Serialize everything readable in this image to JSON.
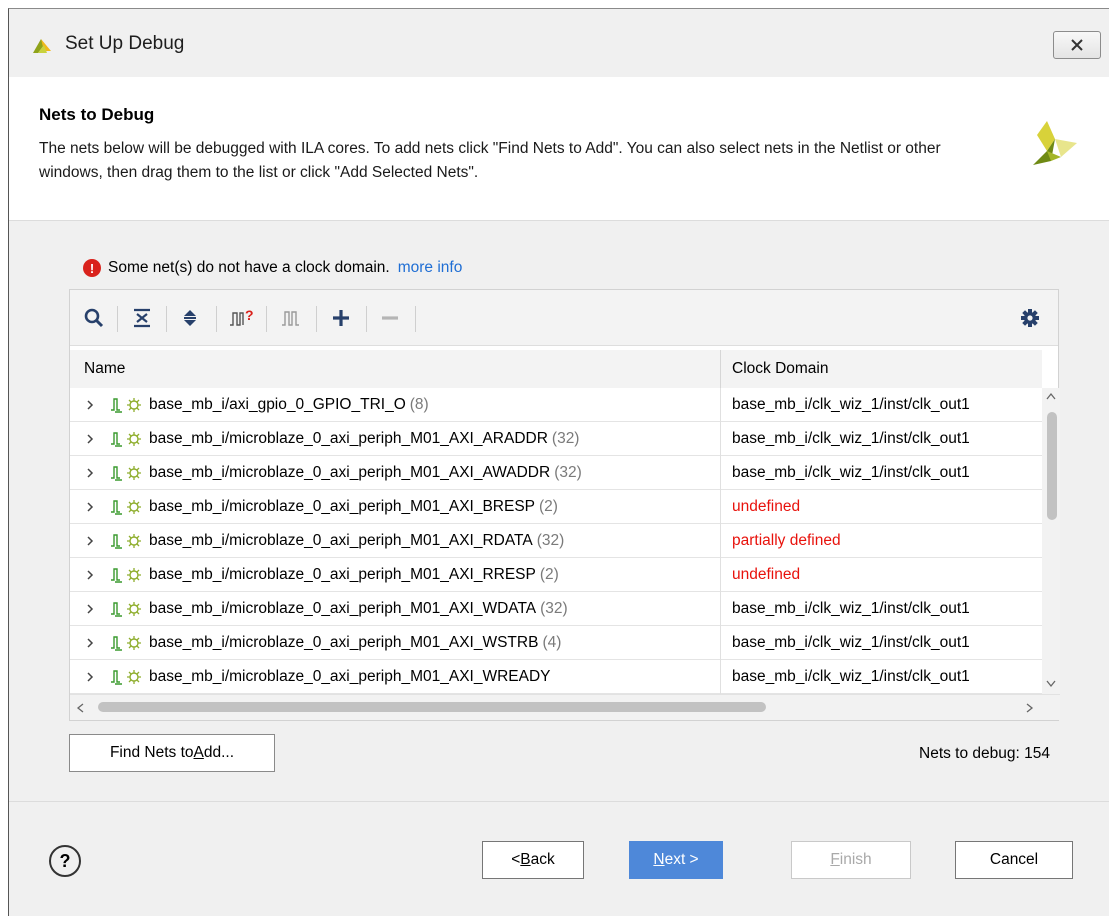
{
  "window": {
    "title": "Set Up Debug",
    "close_icon": "close-x-icon"
  },
  "header": {
    "title": "Nets to Debug",
    "description": "The nets below will be debugged with ILA cores. To add nets click \"Find Nets to Add\". You can also select nets in the Netlist or other windows, then drag them to the list or click \"Add Selected Nets\"."
  },
  "warning": {
    "text": "Some net(s) do not have a clock domain.",
    "link": "more info",
    "icon": "error-icon"
  },
  "toolbar": {
    "icons": [
      "search-icon",
      "collapse-all-icon",
      "expand-all-icon",
      "find-nets-icon",
      "nets-icon",
      "add-icon",
      "remove-icon",
      "settings-icon"
    ]
  },
  "table": {
    "columns": [
      "Name",
      "Clock Domain"
    ],
    "rows": [
      {
        "name": "base_mb_i/axi_gpio_0_GPIO_TRI_O",
        "count": "(8)",
        "clock": "base_mb_i/clk_wiz_1/inst/clk_out1",
        "clock_status": "defined"
      },
      {
        "name": "base_mb_i/microblaze_0_axi_periph_M01_AXI_ARADDR",
        "count": "(32)",
        "clock": "base_mb_i/clk_wiz_1/inst/clk_out1",
        "clock_status": "defined"
      },
      {
        "name": "base_mb_i/microblaze_0_axi_periph_M01_AXI_AWADDR",
        "count": "(32)",
        "clock": "base_mb_i/clk_wiz_1/inst/clk_out1",
        "clock_status": "defined"
      },
      {
        "name": "base_mb_i/microblaze_0_axi_periph_M01_AXI_BRESP",
        "count": "(2)",
        "clock": "undefined",
        "clock_status": "undefined"
      },
      {
        "name": "base_mb_i/microblaze_0_axi_periph_M01_AXI_RDATA",
        "count": "(32)",
        "clock": "partially defined",
        "clock_status": "partial"
      },
      {
        "name": "base_mb_i/microblaze_0_axi_periph_M01_AXI_RRESP",
        "count": "(2)",
        "clock": "undefined",
        "clock_status": "undefined"
      },
      {
        "name": "base_mb_i/microblaze_0_axi_periph_M01_AXI_WDATA",
        "count": "(32)",
        "clock": "base_mb_i/clk_wiz_1/inst/clk_out1",
        "clock_status": "defined"
      },
      {
        "name": "base_mb_i/microblaze_0_axi_periph_M01_AXI_WSTRB",
        "count": "(4)",
        "clock": "base_mb_i/clk_wiz_1/inst/clk_out1",
        "clock_status": "defined"
      },
      {
        "name": "base_mb_i/microblaze_0_axi_periph_M01_AXI_WREADY",
        "count": "",
        "clock": "base_mb_i/clk_wiz_1/inst/clk_out1",
        "clock_status": "defined"
      }
    ]
  },
  "actions": {
    "find_nets_label_pre": "Find Nets to ",
    "find_nets_label_mnemonic": "A",
    "find_nets_label_post": "dd...",
    "nets_to_debug": "Nets to debug: 154"
  },
  "footer": {
    "help": "?",
    "back_pre": "< ",
    "back_mnemonic": "B",
    "back_post": "ack",
    "next_mnemonic": "N",
    "next_post": "ext >",
    "finish_mnemonic": "F",
    "finish_post": "inish",
    "cancel": "Cancel"
  },
  "colors": {
    "accent": "#4e88d9",
    "link": "#1f6ed4",
    "error": "#e8120c",
    "net_green": "#3a9a2e"
  }
}
